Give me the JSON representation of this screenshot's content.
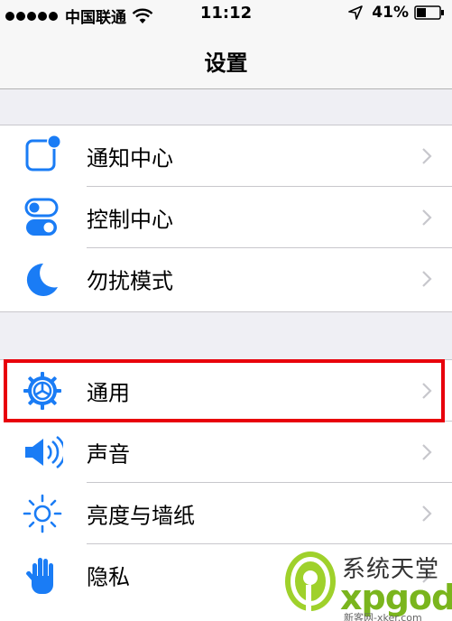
{
  "status_bar": {
    "carrier": "中国联通",
    "time": "11:12",
    "battery": "41%"
  },
  "nav": {
    "title": "设置"
  },
  "groups": [
    {
      "items": [
        {
          "label": "通知中心",
          "icon": "notification-center-icon"
        },
        {
          "label": "控制中心",
          "icon": "control-center-icon"
        },
        {
          "label": "勿扰模式",
          "icon": "moon-icon"
        }
      ]
    },
    {
      "items": [
        {
          "label": "通用",
          "icon": "gear-icon",
          "highlighted": true
        },
        {
          "label": "声音",
          "icon": "speaker-icon"
        },
        {
          "label": "亮度与墙纸",
          "icon": "brightness-icon"
        },
        {
          "label": "隐私",
          "icon": "hand-icon"
        }
      ]
    }
  ],
  "colors": {
    "accent": "#1a7cf5",
    "highlight_border": "#e8000b",
    "background": "#efeff4"
  },
  "watermark": {
    "logo_text": "系统天堂",
    "brand": "xpgod",
    "site": "新客网-xker.com"
  }
}
